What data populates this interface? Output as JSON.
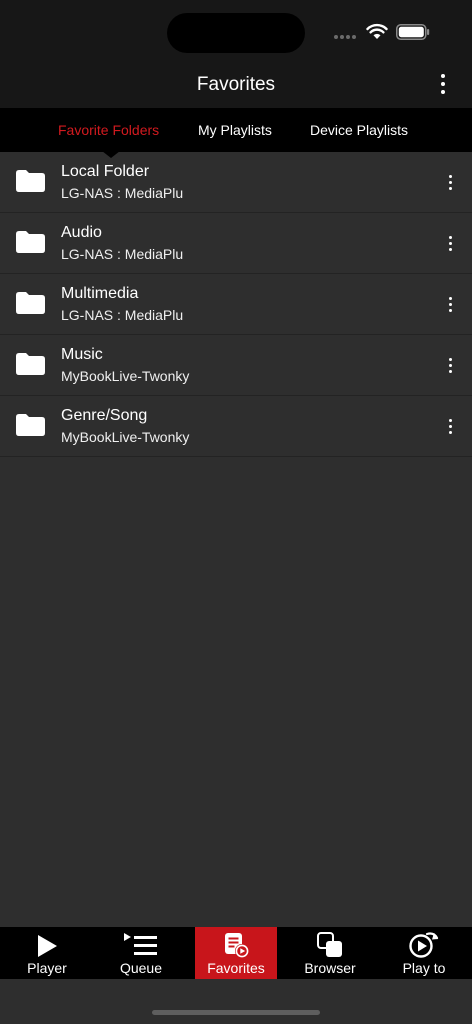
{
  "header": {
    "title": "Favorites"
  },
  "tabs": [
    {
      "label": "Favorite Folders",
      "active": true
    },
    {
      "label": "My Playlists",
      "active": false
    },
    {
      "label": "Device Playlists",
      "active": false
    }
  ],
  "items": [
    {
      "title": "Local Folder",
      "subtitle": "LG-NAS : MediaPlu"
    },
    {
      "title": "Audio",
      "subtitle": "LG-NAS : MediaPlu"
    },
    {
      "title": "Multimedia",
      "subtitle": "LG-NAS : MediaPlu"
    },
    {
      "title": "Music",
      "subtitle": "MyBookLive-Twonky"
    },
    {
      "title": "Genre/Song",
      "subtitle": "MyBookLive-Twonky"
    }
  ],
  "nav": [
    {
      "label": "Player",
      "icon": "play-icon"
    },
    {
      "label": "Queue",
      "icon": "queue-icon"
    },
    {
      "label": "Favorites",
      "icon": "favorites-icon",
      "active": true
    },
    {
      "label": "Browser",
      "icon": "browser-icon"
    },
    {
      "label": "Play to",
      "icon": "play-to-icon"
    }
  ],
  "colors": {
    "accent": "#c8151b",
    "active_tab": "#d21a1f",
    "background": "#2e2e2e",
    "bar": "#000000"
  }
}
